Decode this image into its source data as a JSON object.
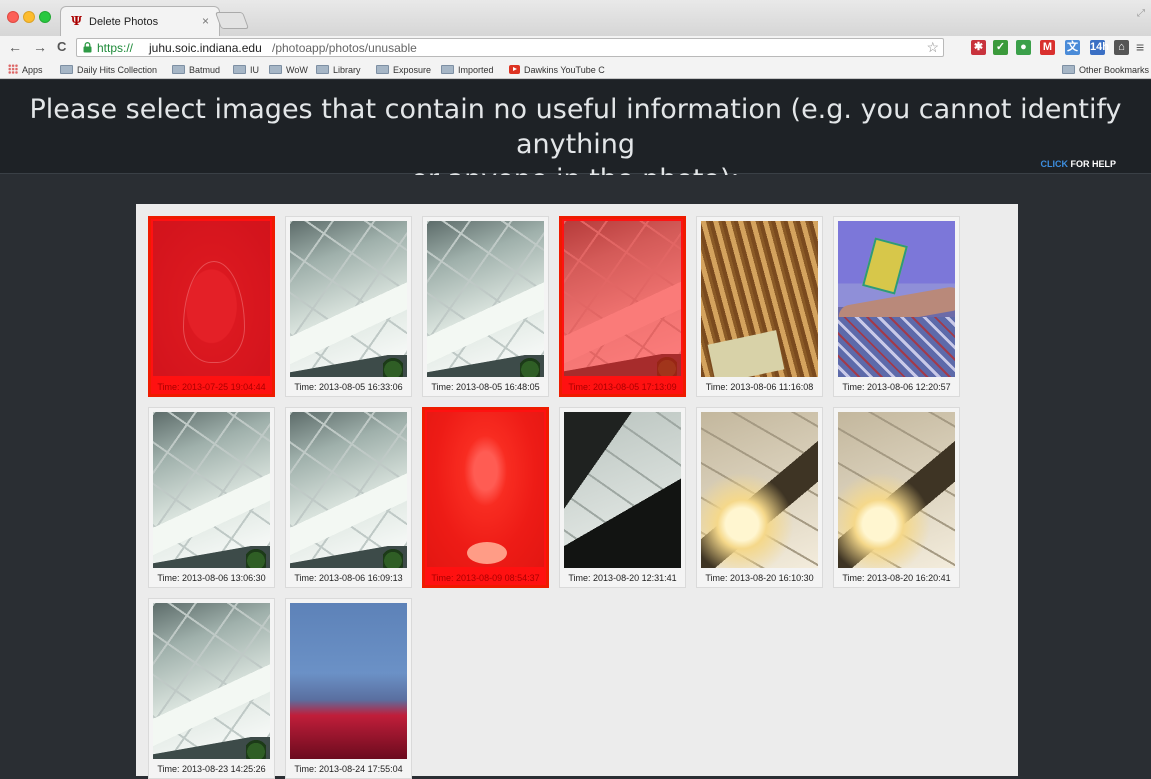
{
  "browser": {
    "tab_title": "Delete Photos",
    "tab_close_glyph": "×",
    "url_scheme": "https://",
    "url_host": "juhu.soic.indiana.edu",
    "url_path": "/photoapp/photos/unusable",
    "back_glyph": "←",
    "forward_glyph": "→",
    "reload_glyph": "C",
    "star_glyph": "☆",
    "menu_glyph": "≡",
    "extensions": [
      {
        "name": "extension-icon-1",
        "glyph": "✱",
        "color": "#c8323c"
      },
      {
        "name": "evernote-check-icon",
        "glyph": "✓",
        "color": "#3b9a3b"
      },
      {
        "name": "evernote-elephant-icon",
        "glyph": "●",
        "color": "#3ba04a"
      },
      {
        "name": "gmail-icon",
        "glyph": "M",
        "color": "#d9302e"
      },
      {
        "name": "translate-icon",
        "glyph": "文",
        "color": "#4a8bd8"
      },
      {
        "name": "calendar-icon",
        "glyph": "14h",
        "color": "#3a6fc4"
      },
      {
        "name": "bank-icon",
        "glyph": "⌂",
        "color": "#555555"
      }
    ],
    "bookmarks": [
      "Apps",
      "Daily Hits Collection",
      "Batmud",
      "IU",
      "WoW",
      "Library",
      "Exposure",
      "Imported",
      "Dawkins YouTube C"
    ],
    "other_bookmarks": "Other Bookmarks"
  },
  "page": {
    "prompt_line1": "Please select images that contain no useful information (e.g. you cannot identify anything",
    "prompt_line2": "or anyone in the photo):",
    "help_click": "CLICK",
    "help_rest": " FOR HELP"
  },
  "photos": [
    {
      "caption": "Time: 2013-07-25 19:04:44",
      "selected": true,
      "style": "red"
    },
    {
      "caption": "Time: 2013-08-05 16:33:06",
      "selected": false,
      "style": "ceiling"
    },
    {
      "caption": "Time: 2013-08-05 16:48:05",
      "selected": false,
      "style": "ceiling"
    },
    {
      "caption": "Time: 2013-08-05 17:13:09",
      "selected": true,
      "style": "ceiling"
    },
    {
      "caption": "Time: 2013-08-06 11:16:08",
      "selected": false,
      "style": "stair"
    },
    {
      "caption": "Time: 2013-08-06 12:20:57",
      "selected": false,
      "style": "arm"
    },
    {
      "caption": "Time: 2013-08-06 13:06:30",
      "selected": false,
      "style": "ceiling"
    },
    {
      "caption": "Time: 2013-08-06 16:09:13",
      "selected": false,
      "style": "ceiling"
    },
    {
      "caption": "Time: 2013-08-09 08:54:37",
      "selected": true,
      "style": "glow"
    },
    {
      "caption": "Time: 2013-08-20 12:31:41",
      "selected": false,
      "style": "dark"
    },
    {
      "caption": "Time: 2013-08-20 16:10:30",
      "selected": false,
      "style": "warm"
    },
    {
      "caption": "Time: 2013-08-20 16:20:41",
      "selected": false,
      "style": "warm"
    },
    {
      "caption": "Time: 2013-08-23 14:25:26",
      "selected": false,
      "style": "ceiling"
    },
    {
      "caption": "Time: 2013-08-24 17:55:04",
      "selected": false,
      "style": "sky"
    }
  ]
}
